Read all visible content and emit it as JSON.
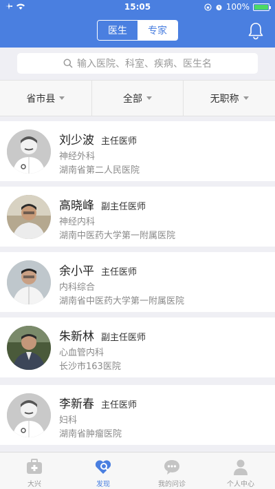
{
  "status": {
    "time": "15:05",
    "battery": "100%"
  },
  "header": {
    "tabs": [
      {
        "label": "医生",
        "active": true
      },
      {
        "label": "专家",
        "active": false
      }
    ]
  },
  "search": {
    "placeholder": "输入医院、科室、疾病、医生名"
  },
  "filters": [
    "省市县",
    "全部",
    "无职称"
  ],
  "doctors": [
    {
      "name": "刘少波",
      "title": "主任医师",
      "dept": "神经外科",
      "hospital": "湖南省第二人民医院"
    },
    {
      "name": "高晓峰",
      "title": "副主任医师",
      "dept": "神经内科",
      "hospital": "湖南中医药大学第一附属医院"
    },
    {
      "name": "余小平",
      "title": "主任医师",
      "dept": "内科综合",
      "hospital": "湖南省中医药大学第一附属医院"
    },
    {
      "name": "朱新林",
      "title": "副主任医师",
      "dept": "心血管内科",
      "hospital": "长沙市163医院"
    },
    {
      "name": "李新春",
      "title": "主任医师",
      "dept": "妇科",
      "hospital": "湖南省肿瘤医院"
    }
  ],
  "tabbar": [
    {
      "label": "大兴",
      "icon": "medkit-icon",
      "active": false
    },
    {
      "label": "发现",
      "icon": "discover-icon",
      "active": true
    },
    {
      "label": "我的问诊",
      "icon": "chat-icon",
      "active": false
    },
    {
      "label": "个人中心",
      "icon": "user-icon",
      "active": false
    }
  ],
  "colors": {
    "primary": "#4a7fe0",
    "background": "#efeff4",
    "battery": "#4cd964"
  }
}
